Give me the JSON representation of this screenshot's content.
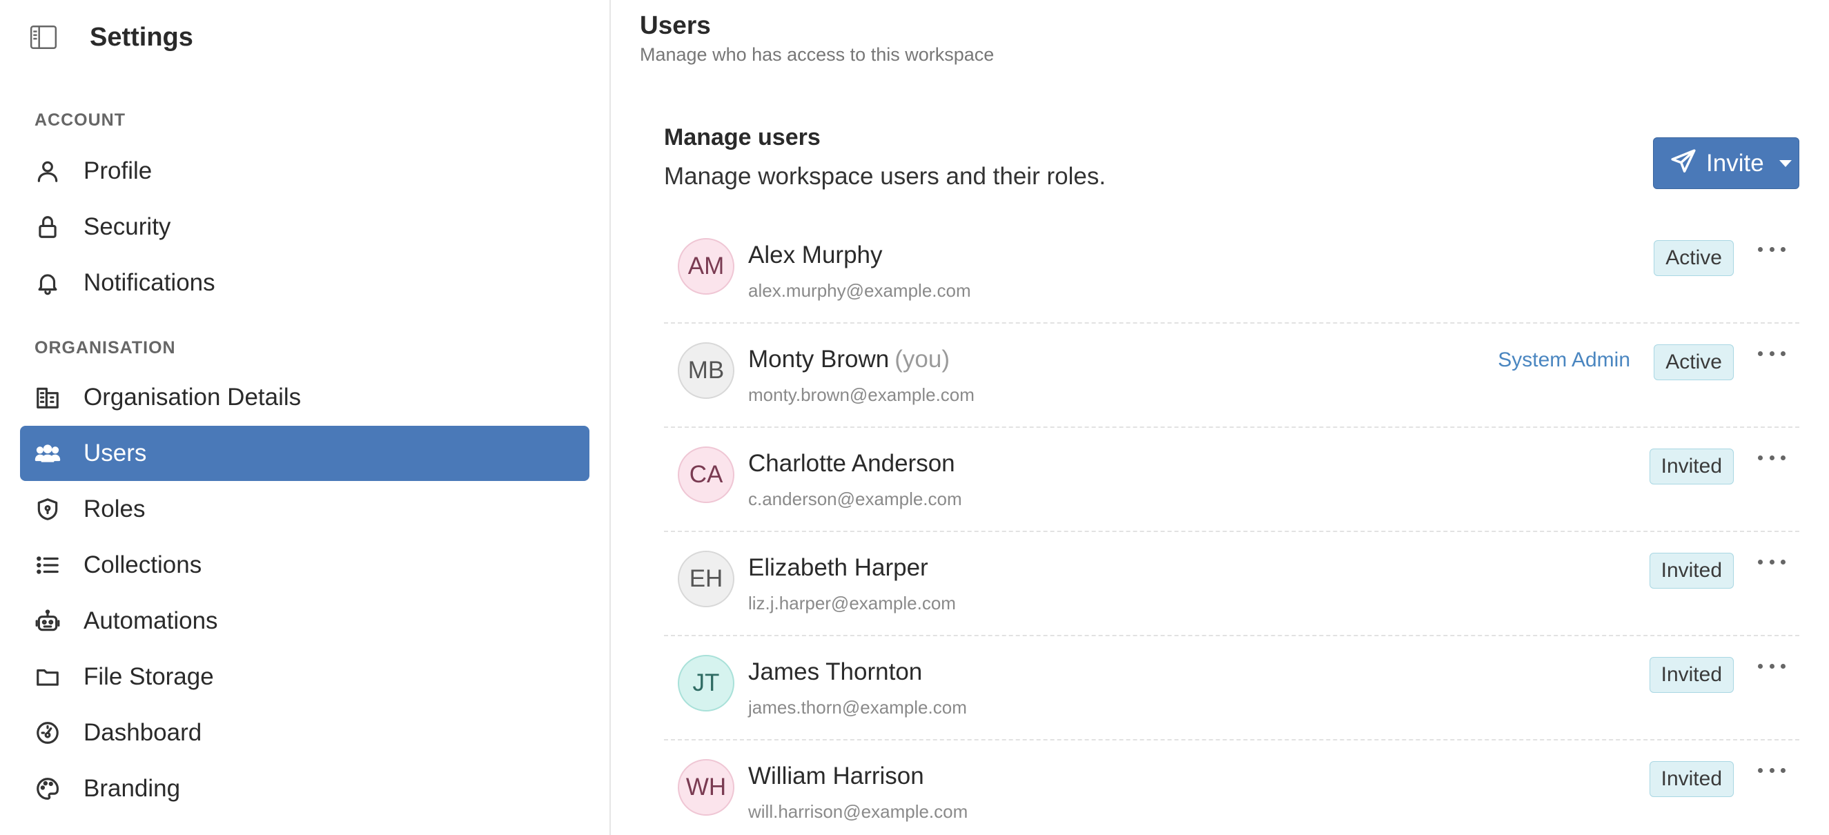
{
  "sidebar": {
    "title": "Settings",
    "sections": {
      "account": "ACCOUNT",
      "organisation": "ORGANISATION"
    },
    "items": [
      {
        "label": "Profile",
        "icon": "user-icon"
      },
      {
        "label": "Security",
        "icon": "lock-icon"
      },
      {
        "label": "Notifications",
        "icon": "bell-icon"
      },
      {
        "label": "Organisation Details",
        "icon": "building-icon"
      },
      {
        "label": "Users",
        "icon": "users-icon",
        "active": true
      },
      {
        "label": "Roles",
        "icon": "shield-icon"
      },
      {
        "label": "Collections",
        "icon": "list-icon"
      },
      {
        "label": "Automations",
        "icon": "robot-icon"
      },
      {
        "label": "File Storage",
        "icon": "folder-icon"
      },
      {
        "label": "Dashboard",
        "icon": "gauge-icon"
      },
      {
        "label": "Branding",
        "icon": "palette-icon"
      }
    ]
  },
  "main": {
    "title": "Users",
    "subtitle": "Manage who has access to this workspace",
    "card_title": "Manage users",
    "card_subtitle": "Manage workspace users and their roles.",
    "invite_label": "Invite",
    "users": [
      {
        "initials": "AM",
        "name": "Alex Murphy",
        "you": "",
        "email": "alex.murphy@example.com",
        "role": "",
        "status": "Active",
        "avatar": "pink"
      },
      {
        "initials": "MB",
        "name": "Monty Brown",
        "you": "(you)",
        "email": "monty.brown@example.com",
        "role": "System Admin",
        "status": "Active",
        "avatar": "grey"
      },
      {
        "initials": "CA",
        "name": "Charlotte Anderson",
        "you": "",
        "email": "c.anderson@example.com",
        "role": "",
        "status": "Invited",
        "avatar": "pink"
      },
      {
        "initials": "EH",
        "name": "Elizabeth Harper",
        "you": "",
        "email": "liz.j.harper@example.com",
        "role": "",
        "status": "Invited",
        "avatar": "grey"
      },
      {
        "initials": "JT",
        "name": "James Thornton",
        "you": "",
        "email": "james.thorn@example.com",
        "role": "",
        "status": "Invited",
        "avatar": "teal"
      },
      {
        "initials": "WH",
        "name": "William Harrison",
        "you": "",
        "email": "will.harrison@example.com",
        "role": "",
        "status": "Invited",
        "avatar": "pink"
      }
    ]
  },
  "colors": {
    "accent": "#4a79b8",
    "badge_bg": "#def1f5",
    "role_link": "#4a86c0"
  }
}
